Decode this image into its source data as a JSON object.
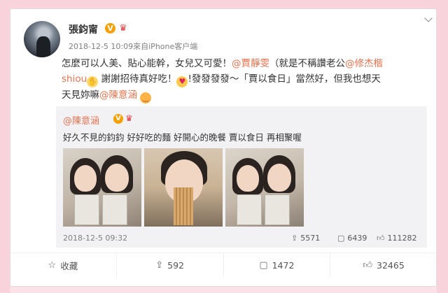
{
  "post": {
    "username": "張鈞甯",
    "verified_badge": "V",
    "meta": "2018-12-5 10:09來自iPhone客户端",
    "line1_a": "怎麼可以人美、貼心能幹，女兒又可愛！",
    "mention1": "@賈靜雯",
    "line1_b": "（就是不稱讚老公",
    "mention2": "@修杰楷",
    "line2_a": "shiou",
    "line2_b": "謝謝招待真好吃！",
    "line2_c": "!發發發發～「賈以食日」當然好，但我也想天",
    "line3_a": "天見妳嘛",
    "mention3": "@陳意涵"
  },
  "repost": {
    "username": "@陳意涵",
    "verified_badge": "V",
    "text": "好久不見的鈞鈞 好好吃的麵 好開心的晚餐 賈以食日 再相聚喔",
    "date": "2018-12-5 09:32",
    "shares": "5571",
    "comments": "6439",
    "likes": "111282"
  },
  "actions": {
    "favorite_label": "收藏",
    "share_count": "592",
    "comment_count": "1472",
    "like_count": "32465"
  },
  "icons": {
    "emoji_1": "thinking-hand-emoji",
    "emoji_2": "heart-eyes-emoji",
    "emoji_3": "sleepy-emoji"
  },
  "colors": {
    "background": "#f9d3dc",
    "mention": "#eb7350",
    "badge": "#f7a000"
  }
}
